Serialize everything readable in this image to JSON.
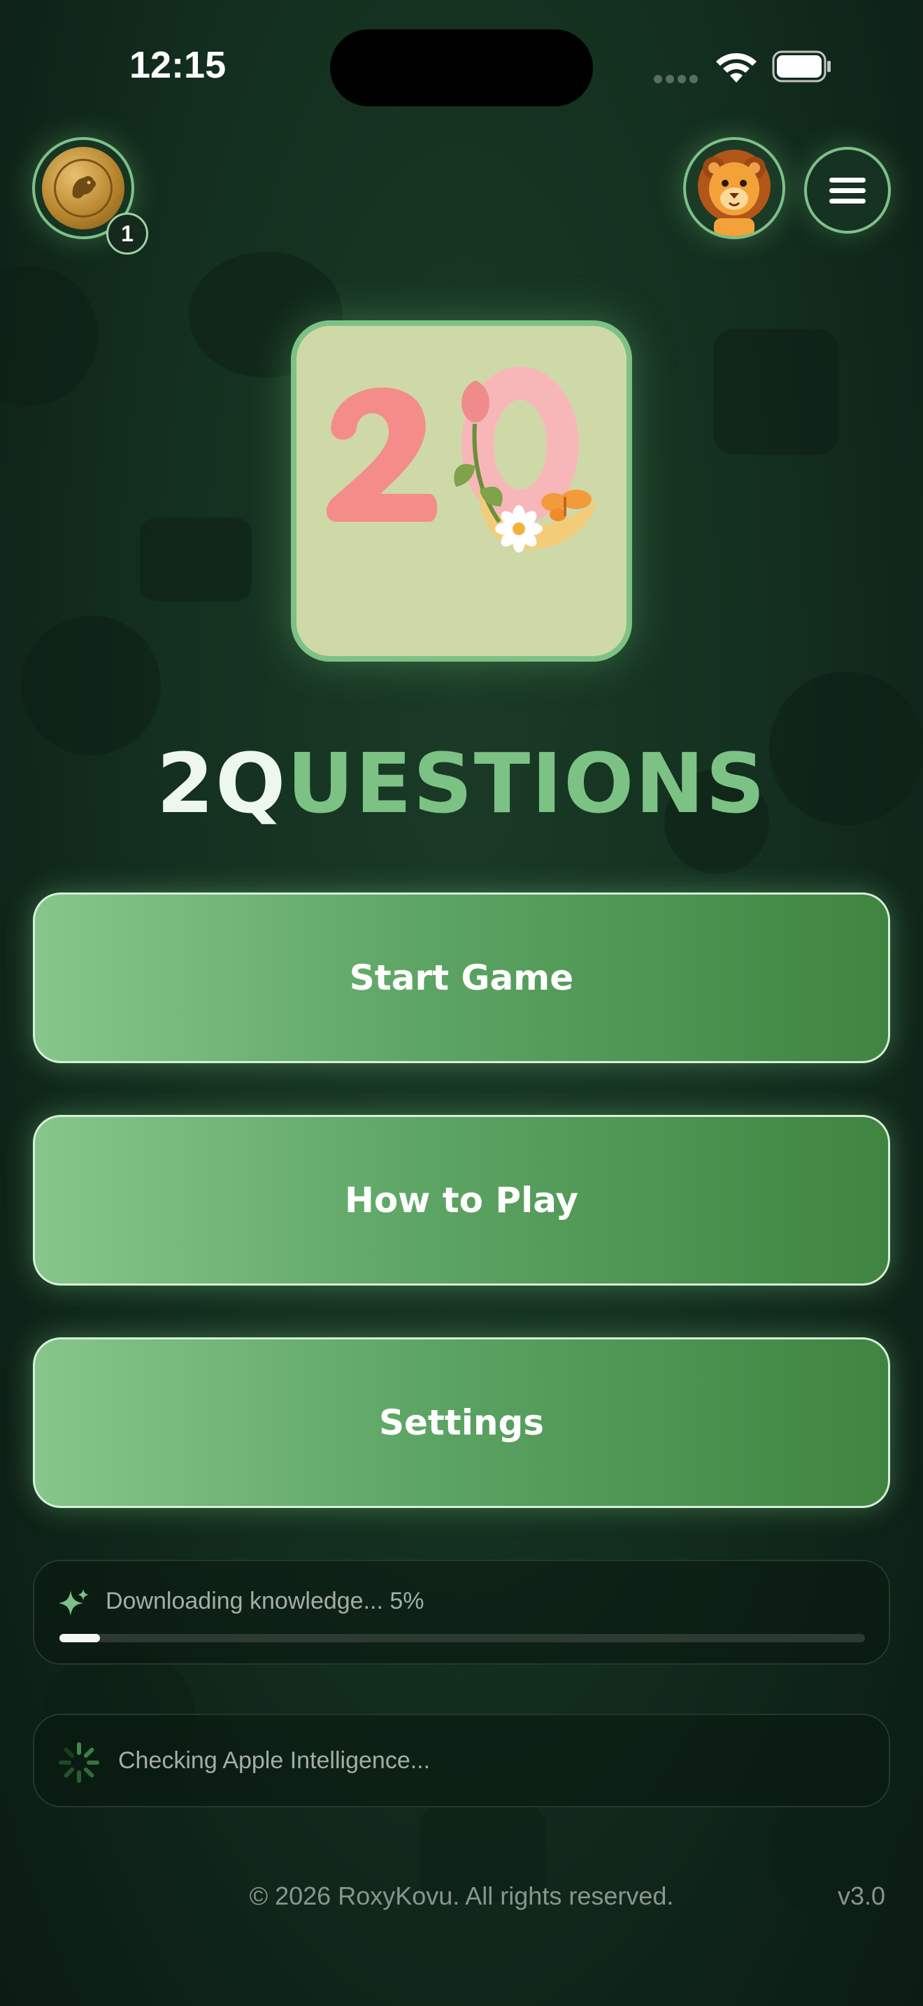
{
  "status_bar": {
    "time": "12:15"
  },
  "header": {
    "coin_badge_count": "1"
  },
  "logo": {
    "title_lead": "2Q",
    "title_rest": "UESTIONS"
  },
  "menu": {
    "start_label": "Start Game",
    "how_to_play_label": "How to Play",
    "settings_label": "Settings"
  },
  "download": {
    "text": "Downloading knowledge... 5%",
    "progress_percent": 5
  },
  "ai_check": {
    "text": "Checking Apple Intelligence..."
  },
  "footer": {
    "copyright": "© 2026 RoxyKovu. All rights reserved.",
    "version": "v3.0"
  },
  "colors": {
    "accent_green": "#7cc285",
    "button_gradient_start": "#86c68a",
    "button_gradient_end": "#3f8440",
    "background": "#143020"
  },
  "icons": [
    "coin-icon",
    "lion-avatar-icon",
    "menu-icon",
    "sparkle-icon",
    "spinner-icon",
    "wifi-icon",
    "battery-icon"
  ]
}
